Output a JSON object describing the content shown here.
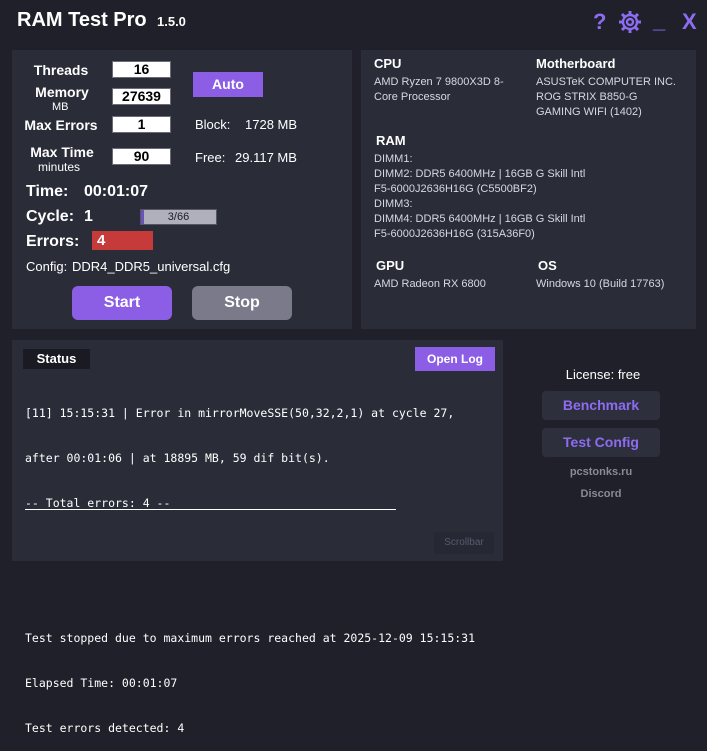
{
  "app": {
    "title": "RAM Test Pro",
    "version": "1.5.0"
  },
  "window": {
    "help": "?",
    "settings_icon": "gear-icon",
    "minimize": "_",
    "close": "X"
  },
  "colors": {
    "accent": "#8c5ee6",
    "background": "#1f2029",
    "panel": "#2a2c38",
    "error": "#c63a3a"
  },
  "settings": {
    "threads_label": "Threads",
    "threads_value": "16",
    "memory_label": "Memory",
    "memory_unit": "MB",
    "memory_value": "27639",
    "max_errors_label": "Max Errors",
    "max_errors_value": "1",
    "max_time_label": "Max Time",
    "max_time_unit": "minutes",
    "max_time_value": "90",
    "auto_label": "Auto",
    "block_label": "Block:",
    "block_value": "1728 MB",
    "free_label": "Free:",
    "free_value": "29.117 MB"
  },
  "run": {
    "time_label": "Time:",
    "time_value": "00:01:07",
    "cycle_label": "Cycle:",
    "cycle_value": "1",
    "progress_text": "3/66",
    "progress_fraction": 0.045,
    "errors_label": "Errors:",
    "errors_value": "4",
    "config_label": "Config:",
    "config_value": "DDR4_DDR5_universal.cfg",
    "start_label": "Start",
    "stop_label": "Stop"
  },
  "hardware": {
    "cpu_label": "CPU",
    "cpu_value": "AMD Ryzen 7 9800X3D 8-Core Processor",
    "mb_label": "Motherboard",
    "mb_line1": "ASUSTeK COMPUTER INC.",
    "mb_line2": "ROG STRIX B850-G",
    "mb_line3": "GAMING WIFI (1402)",
    "ram_label": "RAM",
    "ram_lines": [
      "DIMM1:",
      "DIMM2: DDR5 6400MHz | 16GB G Skill Intl",
      "F5-6000J2636H16G (C5500BF2)",
      "DIMM3:",
      "DIMM4: DDR5 6400MHz | 16GB G Skill Intl",
      "F5-6000J2636H16G (315A36F0)"
    ],
    "gpu_label": "GPU",
    "gpu_value": "AMD Radeon RX 6800",
    "os_label": "OS",
    "os_value": "Windows 10 (Build 17763)"
  },
  "status": {
    "tab_label": "Status",
    "open_log_label": "Open Log",
    "log_lines": [
      "[11] 15:15:31 | Error in mirrorMoveSSE(50,32,2,1) at cycle 27,",
      "after 00:01:06 | at 18895 MB, 59 dif bit(s).",
      "-- Total errors: 4 --",
      "",
      "",
      "Test stopped due to maximum errors reached at 2025-12-09 15:15:31",
      "Elapsed Time: 00:01:07",
      "Test errors detected: 4"
    ],
    "scrollbar_label": "Scrollbar"
  },
  "side": {
    "license": "License: free",
    "benchmark_label": "Benchmark",
    "test_config_label": "Test Config",
    "site": "pcstonks.ru",
    "discord": "Discord"
  }
}
